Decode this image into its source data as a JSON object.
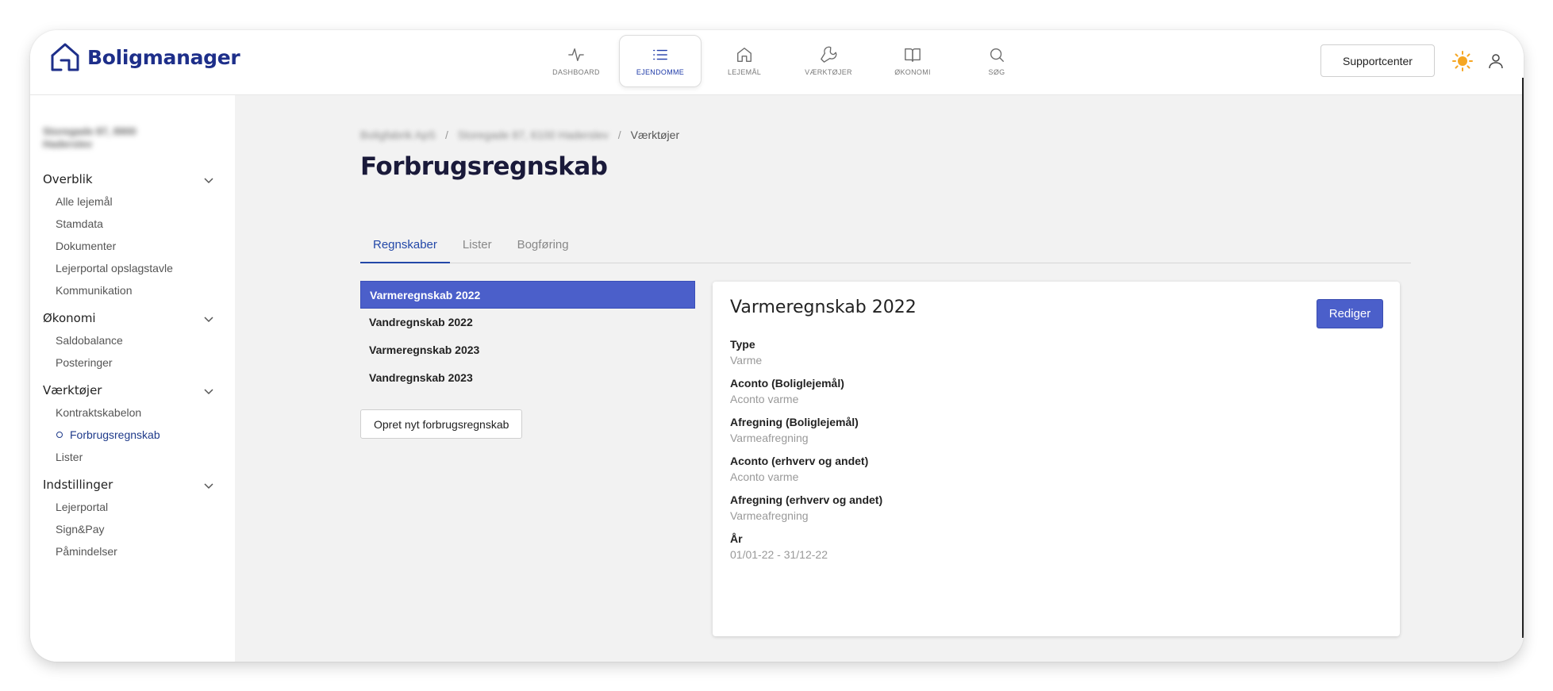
{
  "app": {
    "brand": "Boligmanager"
  },
  "nav": [
    {
      "label": "DASHBOARD",
      "icon": "activity-icon"
    },
    {
      "label": "EJENDOMME",
      "icon": "list-icon",
      "active": true
    },
    {
      "label": "LEJEMÅL",
      "icon": "home-icon"
    },
    {
      "label": "VÆRKTØJER",
      "icon": "wrench-icon"
    },
    {
      "label": "ØKONOMI",
      "icon": "book-icon"
    },
    {
      "label": "SØG",
      "icon": "search-icon"
    }
  ],
  "header": {
    "support_label": "Supportcenter"
  },
  "sidebar": {
    "address": "Storegade 87, 8900 Haderslev",
    "sections": [
      {
        "title": "Overblik",
        "items": [
          "Alle lejemål",
          "Stamdata",
          "Dokumenter",
          "Lejerportal opslagstavle",
          "Kommunikation"
        ]
      },
      {
        "title": "Økonomi",
        "items": [
          "Saldobalance",
          "Posteringer"
        ]
      },
      {
        "title": "Værktøjer",
        "items": [
          "Kontraktskabelon",
          "Forbrugsregnskab",
          "Lister"
        ]
      },
      {
        "title": "Indstillinger",
        "items": [
          "Lejerportal",
          "Sign&Pay",
          "Påmindelser"
        ]
      }
    ]
  },
  "breadcrumb": {
    "crumb1": "Boligfabrik ApS",
    "crumb2": "Storegade 87, 6100 Haderslev",
    "current": "Værktøjer"
  },
  "page": {
    "title": "Forbrugsregnskab"
  },
  "tabs": [
    "Regnskaber",
    "Lister",
    "Bogføring"
  ],
  "accounts": [
    "Varmeregnskab 2022",
    "Vandregnskab 2022",
    "Varmeregnskab 2023",
    "Vandregnskab 2023"
  ],
  "create_button": "Opret nyt forbrugsregnskab",
  "detail": {
    "title": "Varmeregnskab 2022",
    "edit_label": "Rediger",
    "fields": [
      {
        "label": "Type",
        "value": "Varme"
      },
      {
        "label": "Aconto (Boliglejemål)",
        "value": "Aconto varme"
      },
      {
        "label": "Afregning (Boliglejemål)",
        "value": "Varmeafregning"
      },
      {
        "label": "Aconto (erhverv og andet)",
        "value": "Aconto varme"
      },
      {
        "label": "Afregning (erhverv og andet)",
        "value": "Varmeafregning"
      },
      {
        "label": "År",
        "value": "01/01-22 - 31/12-22"
      }
    ]
  },
  "colors": {
    "brand": "#1e2f8a",
    "accent": "#4b5fca",
    "sun": "#f5a623"
  }
}
